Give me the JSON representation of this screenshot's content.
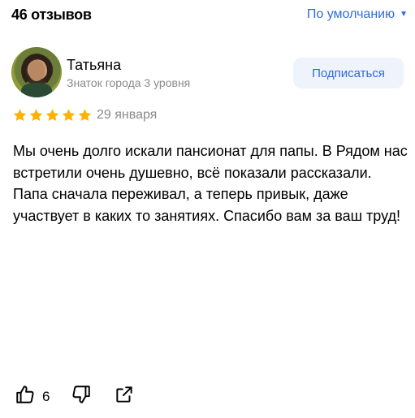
{
  "header": {
    "reviews_count": "46 отзывов",
    "sort_label": "По умолчанию"
  },
  "review": {
    "author_name": "Татьяна",
    "author_level": "Знаток города 3 уровня",
    "subscribe_label": "Подписаться",
    "rating": 5,
    "rating_max": 5,
    "date": "29 января",
    "text": "Мы очень долго искали пансионат для папы. В Рядом нас встретили очень душевно, всё показали рассказали. Папа сначала переживал, а теперь привык, даже участвует в каких то занятиях. Спасибо вам за ваш труд!",
    "likes": "6"
  },
  "icons": {
    "sort": "chevron-down-icon",
    "star": "star-icon",
    "like": "thumbs-up-icon",
    "dislike": "thumbs-down-icon",
    "share": "share-icon"
  },
  "colors": {
    "accent": "#2f6bdb",
    "star": "#fdb100",
    "muted_text": "#8a8a8a",
    "button_bg": "#eef3fc"
  }
}
